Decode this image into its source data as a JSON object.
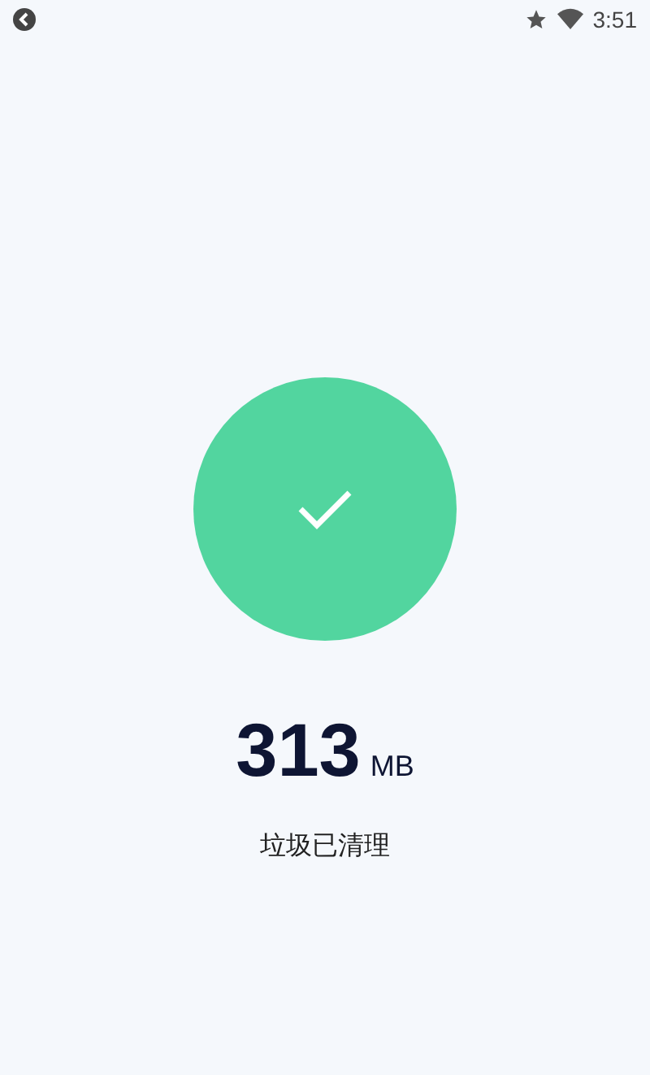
{
  "status_bar": {
    "time": "3:51"
  },
  "result": {
    "amount": "313",
    "unit": "MB",
    "caption": "垃圾已清理"
  }
}
